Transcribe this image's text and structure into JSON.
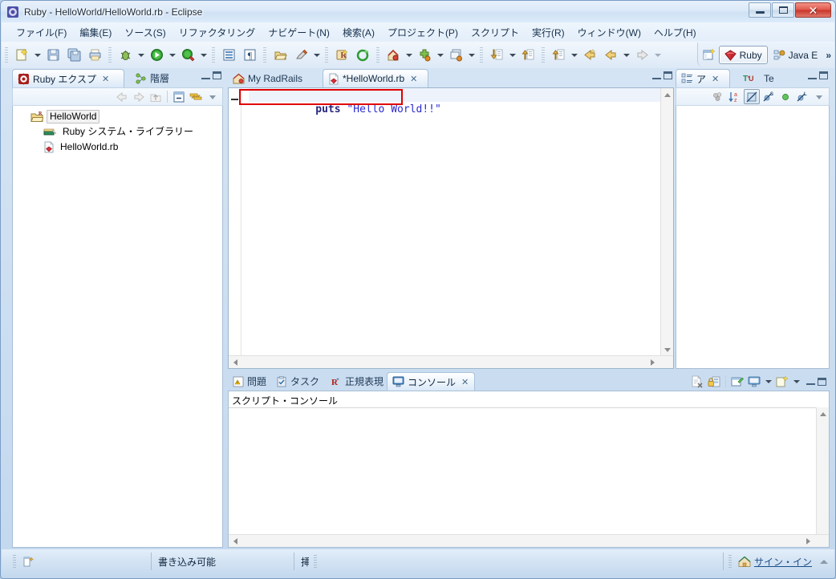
{
  "window": {
    "title": "Ruby - HelloWorld/HelloWorld.rb - Eclipse",
    "icon": "eclipse-icon",
    "minimize_label": "",
    "maximize_label": "",
    "close_label": "✕"
  },
  "menubar": {
    "items": [
      {
        "label": "ファイル(F)",
        "name": "menu-file"
      },
      {
        "label": "編集(E)",
        "name": "menu-edit"
      },
      {
        "label": "ソース(S)",
        "name": "menu-source"
      },
      {
        "label": "リファクタリング",
        "name": "menu-refactor"
      },
      {
        "label": "ナビゲート(N)",
        "name": "menu-navigate"
      },
      {
        "label": "検索(A)",
        "name": "menu-search"
      },
      {
        "label": "プロジェクト(P)",
        "name": "menu-project"
      },
      {
        "label": "スクリプト",
        "name": "menu-script"
      },
      {
        "label": "実行(R)",
        "name": "menu-run"
      },
      {
        "label": "ウィンドウ(W)",
        "name": "menu-window"
      },
      {
        "label": "ヘルプ(H)",
        "name": "menu-help"
      }
    ]
  },
  "toolbar": {
    "groups": [
      [
        "new-wizard-icon",
        "dropdown-arrow",
        "save-icon",
        "save-all-icon",
        "print-icon"
      ],
      [
        "debug-icon",
        "dropdown-arrow",
        "run-icon",
        "dropdown-arrow",
        "external-tools-icon",
        "dropdown-arrow"
      ],
      [
        "open-type-icon",
        "show-whitespace-icon"
      ],
      [
        "open-resource-icon",
        "marker-icon",
        "dropdown-arrow"
      ],
      [
        "new-rails-project-icon",
        "refresh-icon"
      ],
      [
        "search-ruby-icon",
        "dropdown-arrow",
        "plugin-icon",
        "dropdown-arrow",
        "window-set-icon",
        "dropdown-arrow"
      ],
      [
        "next-annotation-icon",
        "dropdown-arrow",
        "previous-annotation-icon"
      ],
      [
        "last-edit-icon",
        "dropdown-arrow",
        "back-icon",
        "forward-nav-icon",
        "dropdown-arrow",
        "forward-icon",
        "dropdown-arrow"
      ]
    ]
  },
  "perspective": {
    "open_perspective_label": "",
    "items": [
      {
        "label": "Ruby",
        "active": true,
        "icon": "ruby-diamond-icon",
        "name": "perspective-ruby"
      },
      {
        "label": "Java E",
        "active": false,
        "icon": "java-ee-icon",
        "name": "perspective-java-ee"
      }
    ],
    "overflow": "»"
  },
  "explorer": {
    "tabs": [
      {
        "label": "Ruby エクスプ",
        "active": true,
        "icon": "ruby-explorer-icon",
        "closable": true
      },
      {
        "label": "階層",
        "active": false,
        "icon": "hierarchy-icon",
        "closable": false
      }
    ],
    "toolbar_icons": [
      "back-icon",
      "forward-icon",
      "up-icon",
      "collapse-all-icon",
      "link-with-editor-icon",
      "view-menu-icon"
    ],
    "tree": [
      {
        "label": "HelloWorld",
        "icon": "ruby-project-icon",
        "depth": 0,
        "selected": true
      },
      {
        "label": "Ruby システム・ライブラリー",
        "icon": "library-icon",
        "depth": 1,
        "selected": false
      },
      {
        "label": "HelloWorld.rb",
        "icon": "ruby-file-icon",
        "depth": 1,
        "selected": false
      }
    ]
  },
  "editor": {
    "tabs": [
      {
        "label": "My RadRails",
        "active": false,
        "icon": "radrails-icon",
        "closable": false
      },
      {
        "label": "*HelloWorld.rb",
        "active": true,
        "icon": "ruby-file-icon",
        "closable": true
      }
    ],
    "code": {
      "keyword": "puts",
      "space": " ",
      "string": "\"Hello World!!\""
    },
    "annotation": {
      "color": "#e00000",
      "name": "code-highlight-box"
    }
  },
  "outline": {
    "tabs": [
      {
        "label": "ア",
        "active": true,
        "icon": "outline-icon",
        "closable": true
      },
      {
        "label": "Te",
        "active": false,
        "icon": "templates-icon",
        "closable": false
      }
    ],
    "toolbar_icons": [
      "group-icon",
      "sort-az-icon",
      "hide-nonpublic-icon",
      "hide-static-icon",
      "hide-fields-icon",
      "hide-local-icon",
      "view-menu-icon"
    ]
  },
  "bottom": {
    "tabs": [
      {
        "label": "問題",
        "active": false,
        "icon": "problems-icon",
        "closable": false
      },
      {
        "label": "タスク",
        "active": false,
        "icon": "tasks-icon",
        "closable": false
      },
      {
        "label": "正規表現",
        "active": false,
        "icon": "regex-icon",
        "closable": false
      },
      {
        "label": "コンソール",
        "active": true,
        "icon": "console-icon",
        "closable": true
      }
    ],
    "toolbar_icons": [
      "clear-console-icon",
      "scroll-lock-icon",
      "pin-console-icon",
      "display-selected-console-icon",
      "dropdown-arrow",
      "open-console-icon",
      "dropdown-arrow"
    ],
    "console_title": "スクリプト・コンソール"
  },
  "statusbar": {
    "left_icon": "editor-status-icon",
    "writable_label": "書き込み可能",
    "insert_label": "挿",
    "signin_label": "サイン・イン",
    "signin_icon": "radrails-home-icon"
  },
  "colors": {
    "accent_blue": "#2a2ad0",
    "keyword_blue": "#26267c",
    "annotation_red": "#e00000",
    "link_blue": "#1b4f8a",
    "chrome_blue": "#c3d8ee"
  }
}
